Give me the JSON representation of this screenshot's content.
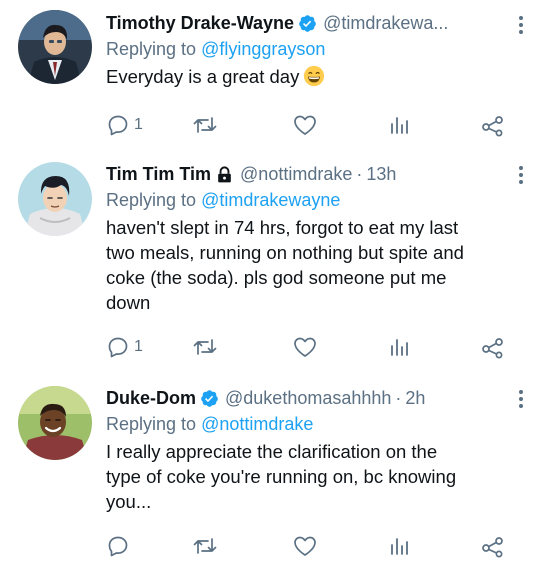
{
  "tweets": [
    {
      "name": "Timothy Drake-Wayne",
      "verified": true,
      "handle": "@timdrakewa...",
      "time": "",
      "reply_prefix": "Replying to",
      "reply_to": "@flyinggrayson",
      "text": "Everyday is a great day",
      "emoji": "grinning-face",
      "reply_count": "1",
      "avatar": "suited-man-avatar"
    },
    {
      "name": "Tim Tim Tim",
      "locked": true,
      "handle": "@nottimdrake",
      "time": "13h",
      "reply_prefix": "Replying to",
      "reply_to": "@timdrakewayne",
      "text_lines": [
        "haven't slept in 74 hrs, forgot to eat my last",
        "two meals, running on nothing but spite and",
        "coke (the soda). pls god someone put me",
        "down"
      ],
      "reply_count": "1",
      "avatar": "hoodie-boy-avatar"
    },
    {
      "name": "Duke-Dom",
      "verified": true,
      "handle": "@dukethomasahhhh",
      "time": "2h",
      "reply_prefix": "Replying to",
      "reply_to": "@nottimdrake",
      "text_lines": [
        "I really appreciate the clarification on the",
        "type of coke you're running on, bc knowing",
        "you..."
      ],
      "reply_count": "",
      "avatar": "smiling-man-avatar"
    }
  ],
  "colors": {
    "accent": "#1da1f2",
    "muted": "#5b7083",
    "text": "#0f1419"
  },
  "icons": [
    "reply-icon",
    "retweet-icon",
    "like-icon",
    "analytics-icon",
    "share-icon",
    "more-icon",
    "verified-badge-icon",
    "lock-icon"
  ]
}
